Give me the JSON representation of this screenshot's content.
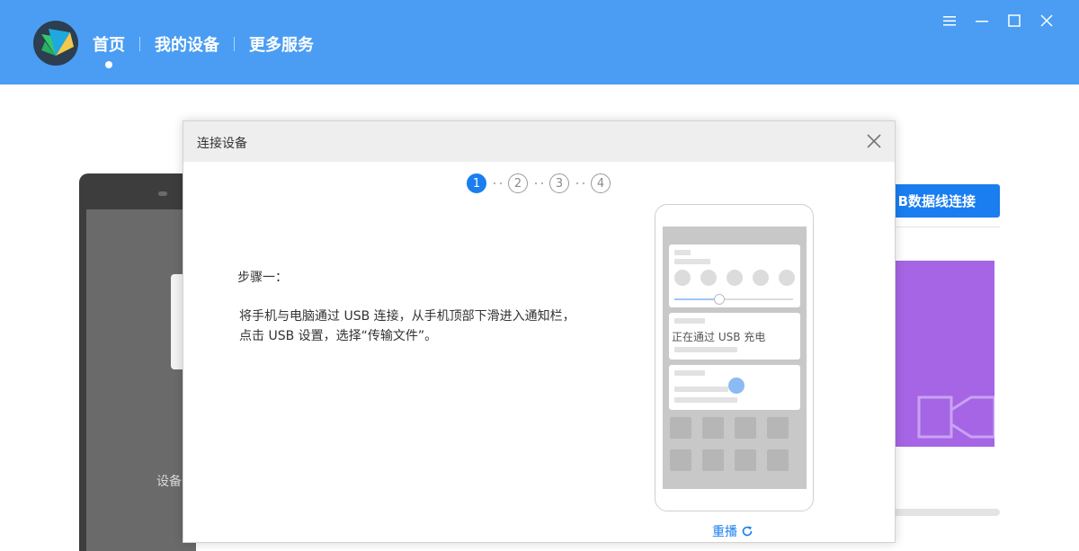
{
  "app": {
    "nav": [
      {
        "label": "首页",
        "active": true
      },
      {
        "label": "我的设备",
        "active": false
      },
      {
        "label": "更多服务",
        "active": false
      }
    ],
    "window_controls": [
      "menu-icon",
      "minimize-icon",
      "maximize-icon",
      "close-icon"
    ]
  },
  "background": {
    "device_text": "设备",
    "usb_button_label": "B数据线连接"
  },
  "dialog": {
    "title": "连接设备",
    "steps": [
      "1",
      "2",
      "3",
      "4"
    ],
    "active_step": 1,
    "step_heading": "步骤一：",
    "step_description": "将手机与电脑通过 USB 连接，从手机顶部下滑进入通知栏，点击 USB 设置，选择“传输文件”。",
    "illustration": {
      "charging_text": "正在通过 USB 充电"
    },
    "replay_label": "重播"
  },
  "colors": {
    "topbar": "#4a9df3",
    "accent": "#1a7df0",
    "purple_card": "#a565e5"
  }
}
